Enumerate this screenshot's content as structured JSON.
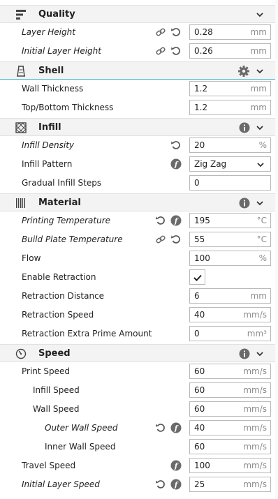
{
  "categories": {
    "quality": {
      "title": "Quality",
      "icon": "quality-icon"
    },
    "shell": {
      "title": "Shell",
      "icon": "shell-icon"
    },
    "infill": {
      "title": "Infill",
      "icon": "infill-icon"
    },
    "material": {
      "title": "Material",
      "icon": "material-icon"
    },
    "speed": {
      "title": "Speed",
      "icon": "speed-icon"
    }
  },
  "settings": {
    "layer_height": {
      "label": "Layer Height",
      "value": "0.28",
      "unit": "mm"
    },
    "initial_layer_height": {
      "label": "Initial Layer Height",
      "value": "0.26",
      "unit": "mm"
    },
    "wall_thickness": {
      "label": "Wall Thickness",
      "value": "1.2",
      "unit": "mm"
    },
    "top_bottom_thickness": {
      "label": "Top/Bottom Thickness",
      "value": "1.2",
      "unit": "mm"
    },
    "infill_density": {
      "label": "Infill Density",
      "value": "20",
      "unit": "%"
    },
    "infill_pattern": {
      "label": "Infill Pattern",
      "value": "Zig Zag"
    },
    "gradual_infill_steps": {
      "label": "Gradual Infill Steps",
      "value": "0"
    },
    "printing_temperature": {
      "label": "Printing Temperature",
      "value": "195",
      "unit": "°C"
    },
    "build_plate_temperature": {
      "label": "Build Plate Temperature",
      "value": "55",
      "unit": "°C"
    },
    "flow": {
      "label": "Flow",
      "value": "100",
      "unit": "%"
    },
    "enable_retraction": {
      "label": "Enable Retraction",
      "checked": true
    },
    "retraction_distance": {
      "label": "Retraction Distance",
      "value": "6",
      "unit": "mm"
    },
    "retraction_speed": {
      "label": "Retraction Speed",
      "value": "40",
      "unit": "mm/s"
    },
    "retraction_extra_prime": {
      "label": "Retraction Extra Prime Amount",
      "value": "0",
      "unit": "mm³"
    },
    "print_speed": {
      "label": "Print Speed",
      "value": "60",
      "unit": "mm/s"
    },
    "infill_speed": {
      "label": "Infill Speed",
      "value": "60",
      "unit": "mm/s"
    },
    "wall_speed": {
      "label": "Wall Speed",
      "value": "60",
      "unit": "mm/s"
    },
    "outer_wall_speed": {
      "label": "Outer Wall Speed",
      "value": "40",
      "unit": "mm/s"
    },
    "inner_wall_speed": {
      "label": "Inner Wall Speed",
      "value": "60",
      "unit": "mm/s"
    },
    "travel_speed": {
      "label": "Travel Speed",
      "value": "100",
      "unit": "mm/s"
    },
    "initial_layer_speed": {
      "label": "Initial Layer Speed",
      "value": "25",
      "unit": "mm/s"
    }
  },
  "colors": {
    "accent": "#2fb0ce",
    "icon": "#555555",
    "unit": "#8c8c8c"
  }
}
